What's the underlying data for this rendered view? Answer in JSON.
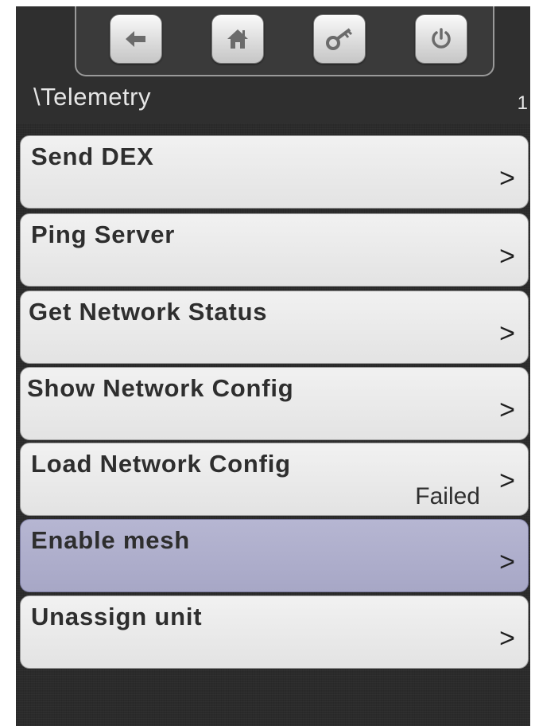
{
  "toolbar": {
    "buttons": [
      {
        "icon": "back-arrow-icon"
      },
      {
        "icon": "home-icon"
      },
      {
        "icon": "key-icon"
      },
      {
        "icon": "power-icon"
      }
    ]
  },
  "breadcrumb": "\\Telemetry",
  "page_number": "1",
  "menu": {
    "items": [
      {
        "label": "Send DEX",
        "arrow": ">"
      },
      {
        "label": "Ping Server",
        "arrow": ">"
      },
      {
        "label": "Get Network Status",
        "arrow": ">"
      },
      {
        "label": "Show Network Config",
        "arrow": ">"
      },
      {
        "label": "Load Network Config",
        "arrow": ">",
        "status": "Failed"
      },
      {
        "label": "Enable mesh",
        "arrow": ">",
        "selected": true
      },
      {
        "label": "Unassign unit",
        "arrow": ">"
      }
    ]
  },
  "colors": {
    "background": "#2b2b2b",
    "item_bg": "#e8e8e8",
    "selected_bg": "#aeaecb"
  }
}
